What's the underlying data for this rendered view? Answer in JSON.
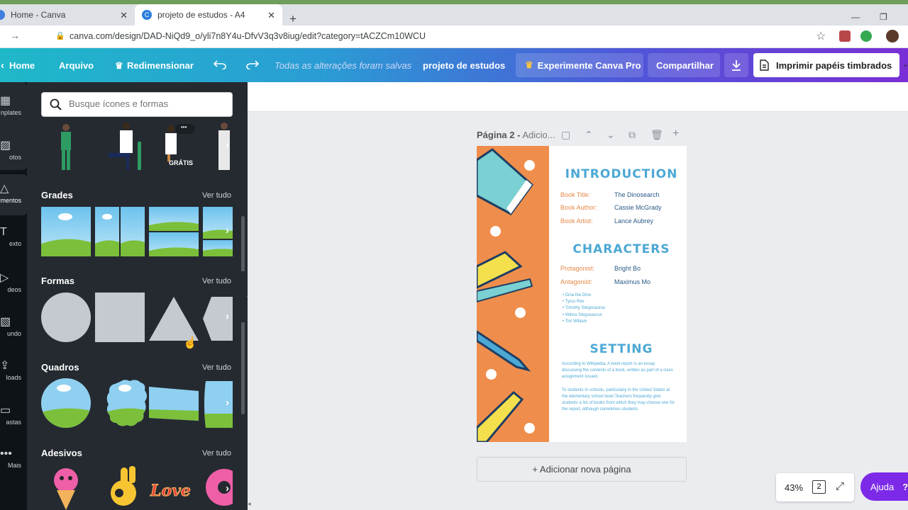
{
  "browser": {
    "tabs": [
      {
        "title": "Home - Canva",
        "close": "✕"
      },
      {
        "title": "projeto de estudos - A4",
        "close": "✕"
      }
    ],
    "new_tab": "+",
    "url": "canva.com/design/DAD-NiQd9_o/yli7n8Y4u-DfvV3q3v8iug/edit?category=tACZCm10WCU",
    "colors": {
      "active_tab": "#ffffff",
      "tab_strip": "#dee1e6"
    }
  },
  "canva_bar": {
    "home": "Home",
    "file": "Arquivo",
    "resize": "Redimensionar",
    "saved_status": "Todas as alterações foram salvas",
    "project_title": "projeto de estudos",
    "pro_button": "Experimente Canva Pro",
    "share_button": "Compartilhar",
    "print_button": "Imprimir papéis timbrados",
    "colors": {
      "gradient_start": "#1fb8c9",
      "gradient_end": "#7a2fd6"
    }
  },
  "rail": [
    {
      "label": "nplates",
      "icon": "templates-icon"
    },
    {
      "label": "otos",
      "icon": "photos-icon"
    },
    {
      "label": "mentos",
      "icon": "elements-icon"
    },
    {
      "label": "exto",
      "icon": "text-icon"
    },
    {
      "label": "deos",
      "icon": "video-icon"
    },
    {
      "label": "undo",
      "icon": "background-icon"
    },
    {
      "label": "loads",
      "icon": "uploads-icon"
    },
    {
      "label": "astas",
      "icon": "folders-icon"
    },
    {
      "label": "Mais",
      "icon": "more-icon"
    }
  ],
  "panel": {
    "search_placeholder": "Busque ícones e formas",
    "free_badge": "GRÁTIS",
    "more_dots": "•••",
    "sections": [
      {
        "title": "Grades",
        "see_all": "Ver tudo"
      },
      {
        "title": "Formas",
        "see_all": "Ver tudo"
      },
      {
        "title": "Quadros",
        "see_all": "Ver tudo"
      },
      {
        "title": "Adesivos",
        "see_all": "Ver tudo"
      }
    ]
  },
  "canvas": {
    "page_label": "Página 2 -",
    "page_title_placeholder": "Adicio...",
    "add_page": "+ Adicionar nova página",
    "zoom": "43%",
    "page_count": "2",
    "help": "Ajuda",
    "help_icon": "?"
  },
  "document": {
    "intro_heading": "INTRODUCTION",
    "intro_rows": [
      {
        "label": "Book Title:",
        "value": "The Dinosearch"
      },
      {
        "label": "Book Author:",
        "value": "Cassie McGrady"
      },
      {
        "label": "Book Artist:",
        "value": "Lance Aubrey"
      }
    ],
    "characters_heading": "CHARACTERS",
    "char_rows": [
      {
        "label": "Protagonist:",
        "value": "Bright Bo"
      },
      {
        "label": "Antagonist:",
        "value": "Maximus Mo"
      }
    ],
    "char_list": [
      "Dina the Dino",
      "Tyrus Rex",
      "Timothy Stegosaurus",
      "Wilma Stegosaurus",
      "Tim William"
    ],
    "setting_heading": "SETTING",
    "setting_p1": "According to Wikipedia, A book report is an essay discussing the contents of a book, written as part of a class assignment issued.",
    "setting_p2": "To students in schools, particularly in the United States at the elementary school level.Teachers frequently give students a list of books from which they may choose one for the report, although sometimes students.",
    "colors": {
      "orange": "#ef8e4c",
      "heading_blue": "#4ca8d4",
      "label_orange": "#e58a4b",
      "value_navy": "#2b5a86"
    }
  }
}
